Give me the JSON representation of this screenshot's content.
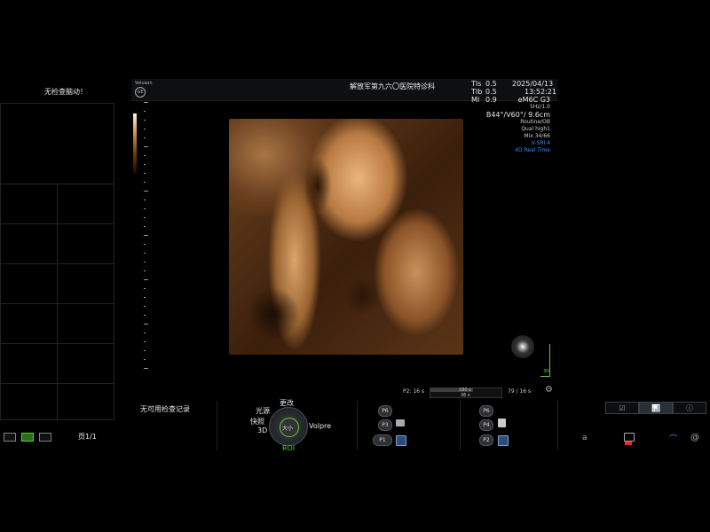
{
  "left_panel": {
    "warning": "无检查脑动！",
    "no_records": "无可用检查记录",
    "page": "页1/1"
  },
  "topbar": {
    "brand": "Voluson",
    "institution": "解放军第九六〇医院特诊科",
    "tis_label": "TIs",
    "tis_value": "0.5",
    "tib_label": "TIb",
    "tib_value": "0.5",
    "mi_label": "MI",
    "mi_value": "0.9",
    "date": "2025/04/13",
    "time": "13:52:21"
  },
  "params": [
    "eM6C G3",
    "5Hz/1.0",
    "B44°/V60°/ 9.6cm",
    "Routine/OB",
    "Qual high1",
    "Mix 34/66"
  ],
  "params_accent": [
    "V-SRI 4",
    "4D Real Time"
  ],
  "label_3d": "3D",
  "cine": {
    "left": "P2:  16 s",
    "mid_top": "180 s",
    "mid_bottom": "36 s",
    "right": "79 / 16 s"
  },
  "rotary": {
    "top": "更改",
    "left_top": "光源",
    "left_mid": "快照",
    "left_bottom": "3D",
    "right": "Volpre",
    "center_top": "大小",
    "center": "大小",
    "bottom": "ROI"
  },
  "presets_left": [
    "P6",
    "P3",
    "P1"
  ],
  "presets_right": [
    "P6",
    "P4",
    "P2"
  ],
  "bottom_right_icons": [
    "a",
    "keyboard-icon",
    "probe-icon",
    "wifi-icon",
    "at-icon"
  ],
  "colors": {
    "accent_blue": "#3d86ff",
    "accent_green": "#5cd13c",
    "image_tone": "#c88c46"
  }
}
